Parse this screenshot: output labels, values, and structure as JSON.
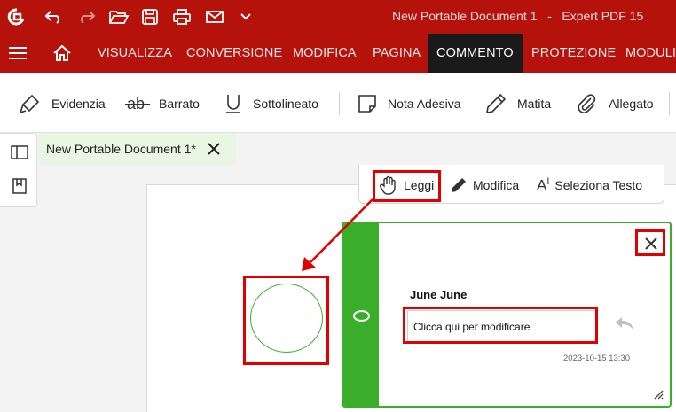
{
  "titlebar": {
    "title": "New Portable Document 1   -   Expert PDF 15",
    "quick_access": [
      "app-logo-icon",
      "undo-icon",
      "redo-icon",
      "open-folder-icon",
      "save-icon",
      "print-icon",
      "email-icon",
      "customize-chevron-icon"
    ]
  },
  "menubar": {
    "items": [
      {
        "label": "VISUALIZZA"
      },
      {
        "label": "CONVERSIONE"
      },
      {
        "label": "MODIFICA"
      },
      {
        "label": "PAGINA"
      },
      {
        "label": "COMMENTO",
        "active": true
      },
      {
        "label": "PROTEZIONE"
      },
      {
        "label": "MODULI"
      }
    ]
  },
  "ribbon": {
    "items": [
      {
        "label": "Evidenzia",
        "icon": "highlighter-icon"
      },
      {
        "label": "Barrato",
        "icon": "strikethrough-icon"
      },
      {
        "label": "Sottolineato",
        "icon": "underline-icon"
      },
      {
        "label": "Nota Adesiva",
        "icon": "sticky-note-icon"
      },
      {
        "label": "Matita",
        "icon": "pencil-icon"
      },
      {
        "label": "Allegato",
        "icon": "paperclip-icon"
      }
    ]
  },
  "tab": {
    "title": "New Portable Document 1*"
  },
  "toolbar": {
    "read": "Leggi",
    "edit": "Modifica",
    "select_text": "Seleziona Testo"
  },
  "comment": {
    "author": "June June",
    "text": "Clicca qui per modificare",
    "timestamp": "2023-10-15 13:30"
  },
  "colors": {
    "brand_red": "#b5120c",
    "annotation_green": "#3aae2a",
    "highlight_red": "#e00000"
  }
}
